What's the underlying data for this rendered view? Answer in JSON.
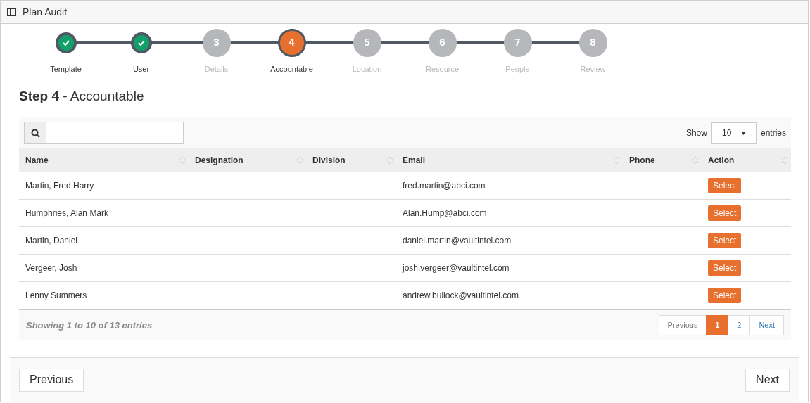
{
  "window": {
    "title": "Plan Audit"
  },
  "steps": [
    {
      "label": "Template",
      "kind": "done"
    },
    {
      "label": "User",
      "kind": "done"
    },
    {
      "number": "3",
      "label": "Details",
      "kind": "pending"
    },
    {
      "number": "4",
      "label": "Accountable",
      "kind": "current"
    },
    {
      "number": "5",
      "label": "Location",
      "kind": "pending"
    },
    {
      "number": "6",
      "label": "Resource",
      "kind": "pending"
    },
    {
      "number": "7",
      "label": "People",
      "kind": "pending"
    },
    {
      "number": "8",
      "label": "Review",
      "kind": "pending"
    }
  ],
  "heading": "**Step 4** - Accountable",
  "table": {
    "length": {
      "before": "Show",
      "value": "10",
      "after": "entries"
    },
    "columns": [
      "Name",
      "Designation",
      "Division",
      "Email",
      "Phone",
      "Action"
    ],
    "rows": [
      {
        "name": "Martin, Fred Harry",
        "email": "fred.martin@abci.com",
        "action": "Select"
      },
      {
        "name": "Humphries, Alan Mark",
        "email": "Alan.Hump@abci.com",
        "action": "Select"
      },
      {
        "name": "Martin, Daniel",
        "email": "daniel.martin@vaultintel.com",
        "action": "Select"
      },
      {
        "name": "Vergeer, Josh",
        "email": "josh.vergeer@vaultintel.com",
        "action": "Select"
      },
      {
        "name": "Lenny Summers",
        "email": "andrew.bullock@vaultintel.com",
        "action": "Select"
      }
    ],
    "info": "Showing 1 to 10 of 13 entries",
    "pagination": [
      {
        "label": "Previous",
        "kind": "prev",
        "selected": false
      },
      {
        "label": "1",
        "kind": "page",
        "selected": true
      },
      {
        "label": "2",
        "kind": "page",
        "selected": false
      },
      {
        "label": "Next",
        "kind": "next",
        "selected": false
      }
    ]
  },
  "footer": {
    "previous": "Previous",
    "next": "Next"
  }
}
